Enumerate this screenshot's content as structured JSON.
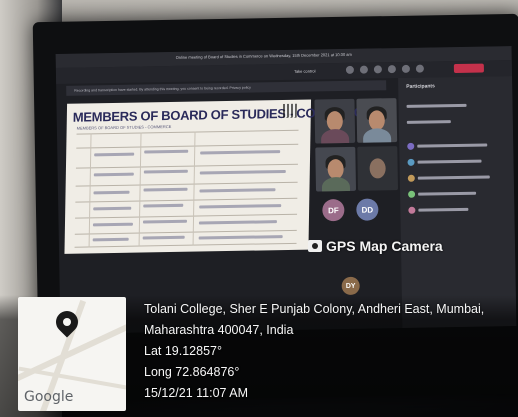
{
  "screen": {
    "meeting_title": "Online meeting of Board of Studies in Commerce on Wednesday, 15th December 2021 at 10:30 am",
    "take_control_label": "Take control",
    "notice_text": "Recording and transcription have started. By attending this meeting, you consent to being recorded. Privacy policy",
    "slide_title": "MEMBERS OF BOARD OF STUDIES - COMMERCE",
    "slide_subtitle": "MEMBERS OF BOARD OF STUDIES - COMMERCE",
    "participants_panel_title": "Participants",
    "avatar_initials": [
      "DF",
      "DD",
      "DY"
    ]
  },
  "overlay": {
    "app_label": "GPS Map Camera"
  },
  "caption": {
    "map_logo": "Google",
    "address_line1": "Tolani College, Sher E Punjab Colony, Andheri East, Mumbai,",
    "address_line2": "Maharashtra 400047, India",
    "latitude": "Lat 19.12857°",
    "longitude": "Long 72.864876°",
    "datetime": "15/12/21 11:07 AM"
  },
  "colors": {
    "leave_button": "#c4314b",
    "accent_purple": "#7b6cc2",
    "slide_heading": "#2a2a5a"
  }
}
